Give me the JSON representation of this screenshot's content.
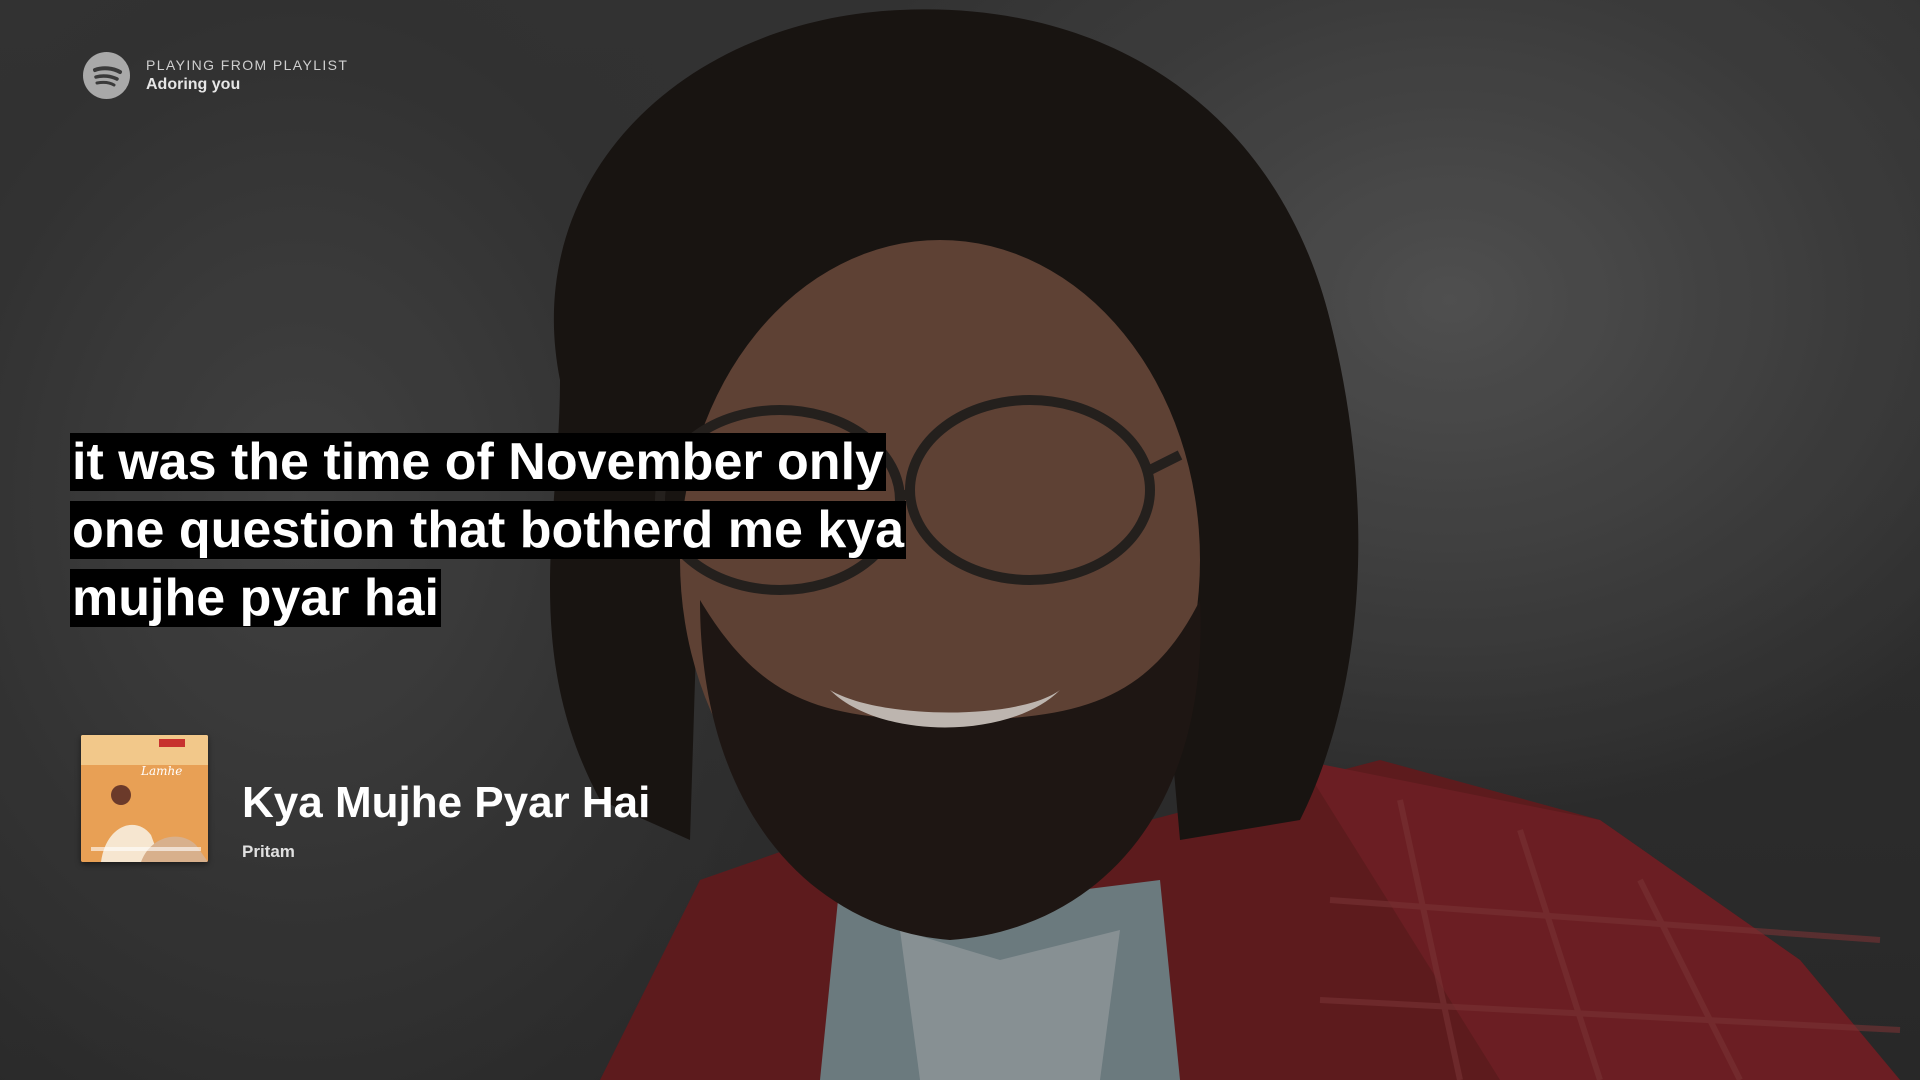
{
  "header": {
    "kicker": "PLAYING FROM PLAYLIST",
    "playlist_name": "Adoring you",
    "logo_icon": "spotify-logo-icon"
  },
  "lyrics": {
    "lines": [
      "it was the time of November  only",
      "one question that botherd me kya",
      "mujhe pyar hai"
    ]
  },
  "now_playing": {
    "title": "Kya Mujhe Pyar Hai",
    "artist": "Pritam",
    "cover_icon": "album-cover-art"
  },
  "colors": {
    "lyric_highlight": "#000000",
    "text": "#ffffff",
    "background": "#3a3a3a"
  }
}
